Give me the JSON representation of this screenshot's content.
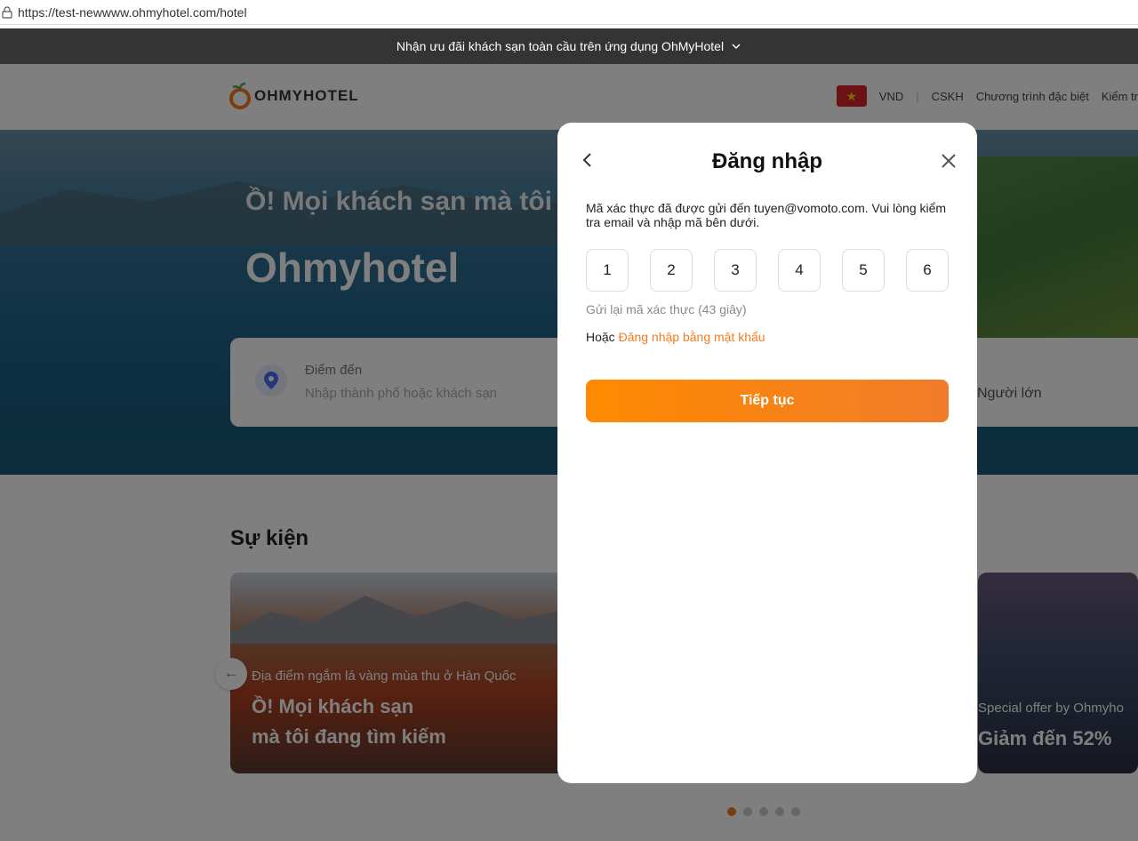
{
  "browser": {
    "url": "https://test-newwww.ohmyhotel.com/hotel"
  },
  "banner": {
    "text": "Nhận ưu đãi khách sạn toàn cầu trên ứng dụng OhMyHotel"
  },
  "header": {
    "logo_text": "OHMYHOTEL",
    "currency": "VND",
    "nav": [
      "CSKH",
      "Chương trình đặc biệt",
      "Kiểm tr"
    ]
  },
  "hero": {
    "subtitle": "Ồ! Mọi khách sạn mà tôi",
    "title": "Ohmyhotel"
  },
  "search": {
    "destination_label": "Điểm đến",
    "destination_placeholder": "Nhập thành phố hoặc khách sạn",
    "guests_label": "Người lớn"
  },
  "events": {
    "title": "Sự kiện",
    "cards": [
      {
        "caption": "Địa điểm ngắm lá vàng mùa thu ở Hàn Quốc",
        "headline_1": "Ồ! Mọi khách sạn",
        "headline_2": "mà tôi đang tìm kiếm"
      },
      {
        "caption": "Special offer by Ohmyho",
        "headline_1": "Giảm đến 52%"
      }
    ],
    "arrow": "←"
  },
  "modal": {
    "title": "Đăng nhập",
    "message": "Mã xác thực đã được gửi đến tuyen@vomoto.com. Vui lòng kiểm tra email và nhập mã bên dưới.",
    "otp_digits": [
      "1",
      "2",
      "3",
      "4",
      "5",
      "6"
    ],
    "resend_text": "Gửi lại mã xác thực (43 giây)",
    "alt_prefix": "Hoặc",
    "alt_link": "Đăng nhập bằng mật khẩu",
    "continue_label": "Tiếp tục"
  },
  "colors": {
    "accent": "#f47b20",
    "banner_bg": "#343434"
  }
}
